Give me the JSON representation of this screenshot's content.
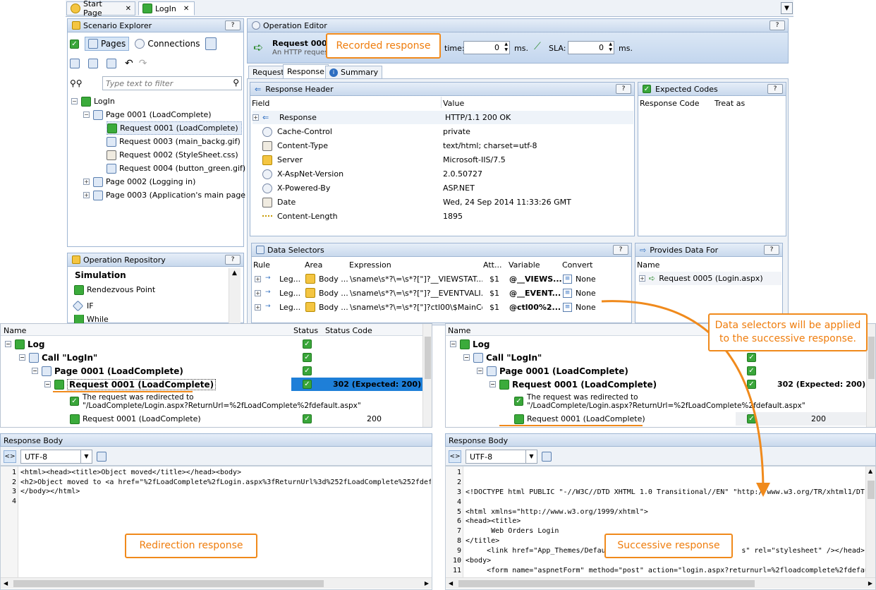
{
  "tabs": {
    "start_page": "Start Page",
    "login": "LogIn"
  },
  "scenario": {
    "title": "Scenario Explorer",
    "pages_btn": "Pages",
    "connections_btn": "Connections",
    "filter_placeholder": "Type text to filter",
    "tree": {
      "root": "LogIn",
      "page1": "Page 0001 (LoadComplete)",
      "req1": "Request 0001 (LoadComplete)",
      "req3": "Request 0003 (main_backg.gif)",
      "req2": "Request 0002 (StyleSheet.css)",
      "req4": "Request 0004 (button_green.gif)",
      "page2": "Page 0002 (Logging in)",
      "page3": "Page 0003 (Application's main page -..."
    }
  },
  "repo": {
    "title": "Operation Repository",
    "group": "Simulation",
    "items": [
      "Rendezvous Point",
      "IF",
      "While"
    ]
  },
  "editor": {
    "title": "Operation Editor",
    "req_name": "Request 0001",
    "req_desc": "An HTTP reques",
    "time_label": "time:",
    "time_value": "0",
    "ms1": "ms.",
    "sla_label": "SLA:",
    "sla_value": "0",
    "ms2": "ms.",
    "tabs": [
      "Request",
      "Response",
      "Summary"
    ]
  },
  "response_header": {
    "title": "Response Header",
    "col_field": "Field",
    "col_value": "Value",
    "rows": [
      {
        "field": "Response",
        "value": "HTTP/1.1 200 OK"
      },
      {
        "field": "Cache-Control",
        "value": "private"
      },
      {
        "field": "Content-Type",
        "value": "text/html; charset=utf-8"
      },
      {
        "field": "Server",
        "value": "Microsoft-IIS/7.5"
      },
      {
        "field": "X-AspNet-Version",
        "value": "2.0.50727"
      },
      {
        "field": "X-Powered-By",
        "value": "ASP.NET"
      },
      {
        "field": "Date",
        "value": "Wed, 24 Sep 2014 11:33:26 GMT"
      },
      {
        "field": "Content-Length",
        "value": "1895"
      }
    ]
  },
  "expected_codes": {
    "title": "Expected Codes",
    "col1": "Response Code",
    "col2": "Treat as"
  },
  "data_selectors": {
    "title": "Data Selectors",
    "cols": [
      "Rule",
      "Area",
      "Expression",
      "Att...",
      "Variable",
      "Convert"
    ],
    "rows": [
      {
        "rule": "Leg...",
        "area": "Body ...",
        "expr": "\\sname\\s*?\\=\\s*?[\"]?__VIEWSTAT...",
        "att": "$1",
        "var": "@__VIEWS...",
        "conv": "None"
      },
      {
        "rule": "Leg...",
        "area": "Body ...",
        "expr": "\\sname\\s*?\\=\\s*?[\"]?__EVENTVALI...",
        "att": "$1",
        "var": "@__EVENT...",
        "conv": "None"
      },
      {
        "rule": "Leg...",
        "area": "Body ...",
        "expr": "\\sname\\s*?\\=\\s*?[\"]?ctl00\\$MainCo...",
        "att": "$1",
        "var": "@ctl00%2...",
        "conv": "None"
      }
    ]
  },
  "provides": {
    "title": "Provides Data For",
    "col": "Name",
    "item": "Request 0005 (Login.aspx)"
  },
  "log_left": {
    "cols": [
      "Name",
      "Status",
      "Status Code"
    ],
    "log": "Log",
    "call": "Call \"LogIn\"",
    "page": "Page 0001 (LoadComplete)",
    "req": "Request 0001 (LoadComplete)",
    "code": "302 (Expected: 200)",
    "redirect1": "The request was redirected to",
    "redirect2": "\"/LoadComplete/Login.aspx?ReturnUrl=%2fLoadComplete%2fdefault.aspx\"",
    "req_sub": "Request 0001 (LoadComplete)",
    "code_sub": "200"
  },
  "log_right": {
    "cols": [
      "Name"
    ],
    "log": "Log",
    "call": "Call \"LogIn\"",
    "page": "Page 0001 (LoadComplete)",
    "req": "Request 0001 (LoadComplete)",
    "code": "302 (Expected: 200)",
    "redirect1": "The request was redirected to",
    "redirect2": "\"/LoadComplete/Login.aspx?ReturnUrl=%2fLoadComplete%2fdefault.aspx\"",
    "req_sub": "Request 0001 (LoadComplete)",
    "code_sub": "200"
  },
  "body_left": {
    "title": "Response Body",
    "encoding": "UTF-8",
    "lines": [
      "<html><head><title>Object moved</title></head><body>",
      "<h2>Object moved to <a href=\"%2fLoadComplete%2fLogin.aspx%3fReturnUrl%3d%252fLoadComplete%252fdef",
      "</body></html>",
      ""
    ]
  },
  "body_right": {
    "title": "Response Body",
    "encoding": "UTF-8",
    "lines": [
      "",
      "",
      "<!DOCTYPE html PUBLIC \"-//W3C//DTD XHTML 1.0 Transitional//EN\" \"http://www.w3.org/TR/xhtml1/DT",
      "",
      "<html xmlns=\"http://www.w3.org/1999/xhtml\">",
      "<head><title>",
      "      Web Orders Login",
      "</title>",
      "     <link href=\"App_Themes/Default                              s\" rel=\"stylesheet\" /></head>",
      "<body>",
      "     <form name=\"aspnetForm\" method=\"post\" action=\"login.aspx?returnurl=%2floadcomplete%2fdefau"
    ]
  },
  "callouts": {
    "recorded": "Recorded response",
    "selectors": "Data selectors will be applied to the successive response.",
    "redirection": "Redirection response",
    "successive": "Successive response"
  },
  "colors": {
    "accent": "#f08a1c",
    "selection": "#1e7fd8",
    "panel_header": "#c9d9ed"
  }
}
